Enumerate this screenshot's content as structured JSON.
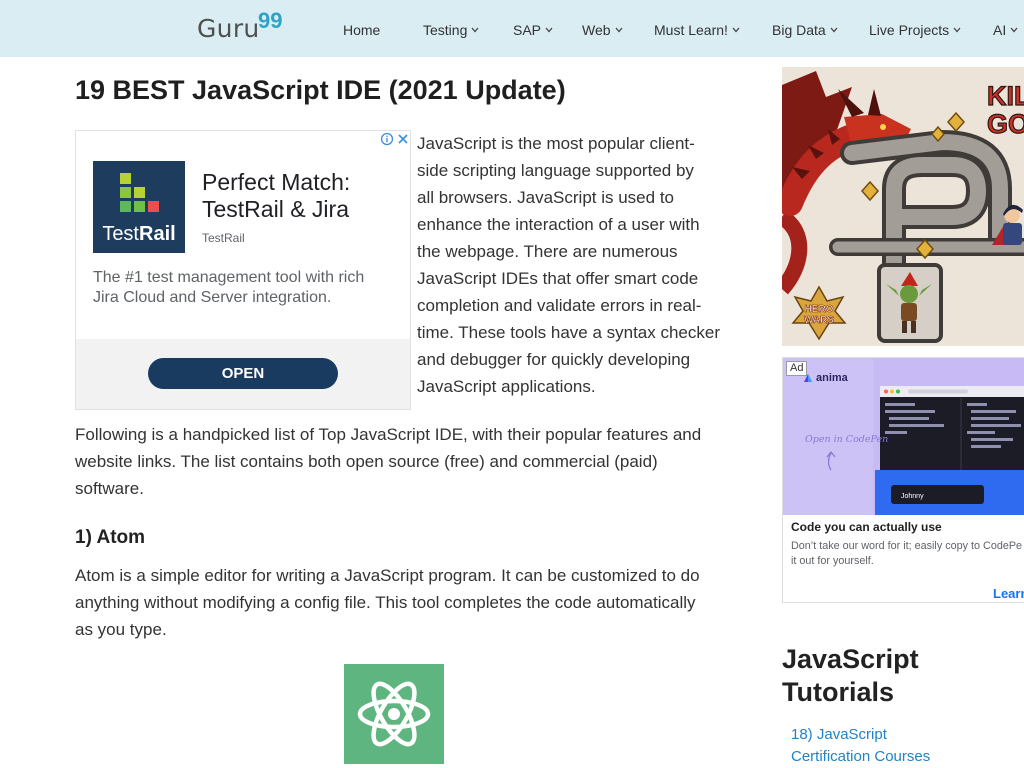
{
  "header": {
    "logo": {
      "word": "Guru",
      "number": "99"
    },
    "nav": [
      {
        "label": "Home"
      },
      {
        "label": "Testing",
        "icon": "chevron-down-icon"
      },
      {
        "label": "SAP",
        "icon": "chevron-down-icon"
      },
      {
        "label": "Web",
        "icon": "chevron-down-icon"
      },
      {
        "label": "Must Learn!",
        "icon": "chevron-down-icon"
      },
      {
        "label": "Big Data",
        "icon": "chevron-down-icon"
      },
      {
        "label": "Live Projects",
        "icon": "chevron-down-icon"
      },
      {
        "label": "AI",
        "icon": "chevron-down-icon"
      }
    ]
  },
  "article": {
    "title": "19 BEST JavaScript IDE (2021 Update)",
    "intro_lines": [
      "JavaScript is the most popular client-",
      "side scripting language supported by",
      "all browsers. JavaScript is used to",
      "enhance the interaction of a user with",
      "the webpage. There are numerous",
      "JavaScript IDEs that offer smart code",
      "completion and validate errors in real-",
      "time. These tools have a syntax checker",
      "and debugger for quickly developing",
      "JavaScript applications."
    ],
    "list_intro_lines": [
      "Following is a handpicked list of Top JavaScript IDE, with their popular features and",
      "website links. The list contains both open source (free) and commercial (paid)",
      "software."
    ],
    "sections": [
      {
        "heading": "1) Atom",
        "lines": [
          "Atom is a simple editor for writing a JavaScript program. It can be customized to do",
          "anything without modifying a config file. This tool completes the code automatically",
          "as you type."
        ],
        "logo_icon": "atom-logo-icon"
      }
    ]
  },
  "ad_inline": {
    "info_icon": "info-icon",
    "close_icon": "close-icon",
    "logo_text_light": "Test",
    "logo_text_bold": "Rail",
    "headline_lines": [
      "Perfect Match:",
      "TestRail & Jira"
    ],
    "brand": "TestRail",
    "desc_lines": [
      "The #1 test management tool with rich",
      "Jira Cloud and Server integration."
    ],
    "cta": "OPEN"
  },
  "sidebar": {
    "game_ad": {
      "headline_lines": [
        "KIL",
        "GO"
      ],
      "logo_lines": [
        "HERO",
        "WARS"
      ]
    },
    "anima_ad": {
      "badge": "Ad",
      "brand": "anima",
      "overlay_text": "Open in CodePen",
      "input_text": "Johnny",
      "title": "Code you can actually use",
      "desc_lines": [
        "Don’t take our word for it; easily copy to CodePe",
        "it out for yourself."
      ],
      "cta": "Learn"
    },
    "tutorials": {
      "heading_lines": [
        "JavaScript",
        "Tutorials"
      ],
      "links": [
        {
          "lines": [
            "18) JavaScript",
            "Certification Courses"
          ]
        }
      ]
    }
  },
  "colors": {
    "header_bg": "#d9edf2",
    "logo_accent": "#2ea3c6",
    "link": "#2183c4",
    "ad_button": "#183b5f",
    "atom_green": "#5fb57f"
  }
}
